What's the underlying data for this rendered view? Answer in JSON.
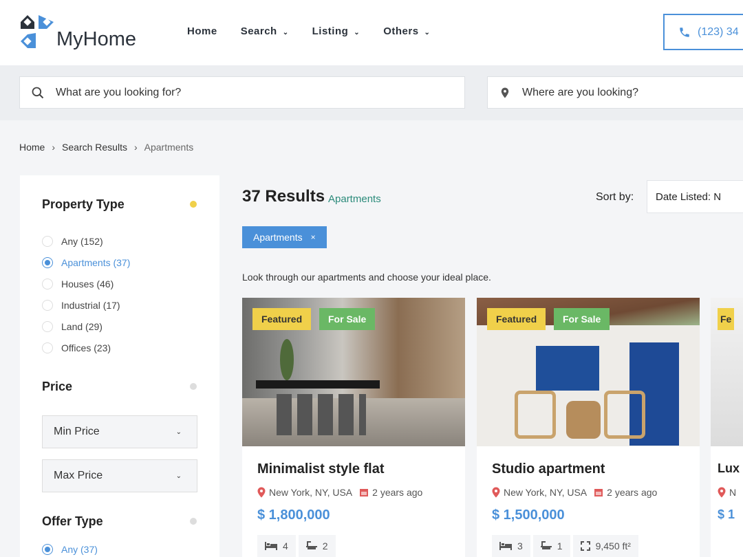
{
  "header": {
    "logo": "MyHome",
    "nav": [
      {
        "label": "Home",
        "dropdown": false
      },
      {
        "label": "Search",
        "dropdown": true
      },
      {
        "label": "Listing",
        "dropdown": true
      },
      {
        "label": "Others",
        "dropdown": true
      }
    ],
    "phone": "(123) 34"
  },
  "search": {
    "keyword_placeholder": "What are you looking for?",
    "location_placeholder": "Where are you looking?"
  },
  "breadcrumb": [
    "Home",
    "Search Results",
    "Apartments"
  ],
  "sidebar": {
    "property_type": {
      "title": "Property Type",
      "options": [
        "Any (152)",
        "Apartments (37)",
        "Houses (46)",
        "Industrial (17)",
        "Land (29)",
        "Offices (23)"
      ],
      "selected": "Apartments (37)"
    },
    "price": {
      "title": "Price",
      "min": "Min Price",
      "max": "Max Price"
    },
    "offer_type": {
      "title": "Offer Type",
      "first_option": "Any (37)"
    }
  },
  "results": {
    "count": "37 Results",
    "category": "Apartments",
    "sort_label": "Sort by:",
    "sort_value": "Date Listed: N",
    "chip": "Apartments",
    "chip_close": "×",
    "description": "Look through our apartments and choose your ideal place."
  },
  "listings": [
    {
      "title": "Minimalist style flat",
      "location": "New York, NY, USA",
      "date": "2 years ago",
      "price": "$ 1,800,000",
      "beds": "4",
      "baths": "2",
      "area": null,
      "badges": [
        "Featured",
        "For Sale"
      ]
    },
    {
      "title": "Studio apartment",
      "location": "New York, NY, USA",
      "date": "2 years ago",
      "price": "$ 1,500,000",
      "beds": "3",
      "baths": "1",
      "area": "9,450 ft²",
      "badges": [
        "Featured",
        "For Sale"
      ]
    },
    {
      "title": "Lux",
      "location": "N",
      "date": "",
      "price": "$ 1",
      "badges": [
        "Fe"
      ]
    }
  ],
  "colors": {
    "accent": "#4a90d9",
    "featured": "#f0d04a",
    "for_sale": "#6ab865",
    "category": "#2a8a7a",
    "meta_icon": "#e05a5a"
  }
}
